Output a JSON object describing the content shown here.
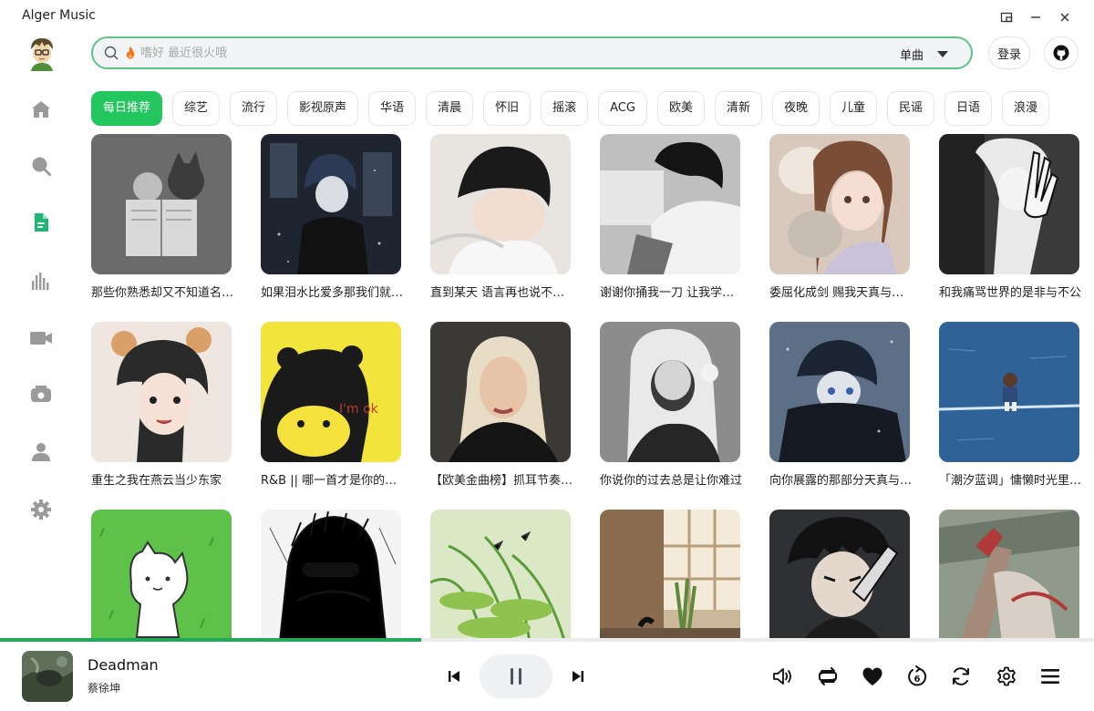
{
  "window": {
    "title": "Alger Music"
  },
  "search": {
    "placeholder": "嗜好 最近很火哦",
    "value": "",
    "type_label": "单曲"
  },
  "header": {
    "login_label": "登录"
  },
  "tabs": [
    "每日推荐",
    "综艺",
    "流行",
    "影视原声",
    "华语",
    "清晨",
    "怀旧",
    "摇滚",
    "ACG",
    "欧美",
    "清新",
    "夜晚",
    "儿童",
    "民谣",
    "日语",
    "浪漫"
  ],
  "active_tab": 0,
  "playlists": [
    {
      "title": "那些你熟悉却又不知道名字的歌"
    },
    {
      "title": "如果泪水比爱多那我们就不要再见了"
    },
    {
      "title": "直到某天 语言再也说不出口"
    },
    {
      "title": "谢谢你捅我一刀 让我学会了成长"
    },
    {
      "title": "委屈化成剑 赐我天真与勇敢"
    },
    {
      "title": "和我痛骂世界的是非与不公"
    },
    {
      "title": "重生之我在燕云当少东家"
    },
    {
      "title": "R&B || 哪一首才是你的心头好"
    },
    {
      "title": "【欧美金曲榜】抓耳节奏一听就上头"
    },
    {
      "title": "你说你的过去总是让你难过"
    },
    {
      "title": "向你展露的那部分天真与脆弱"
    },
    {
      "title": "「潮汐蓝调」慵懒时光里的温柔"
    },
    {
      "title": ""
    },
    {
      "title": ""
    },
    {
      "title": ""
    },
    {
      "title": ""
    },
    {
      "title": ""
    },
    {
      "title": ""
    }
  ],
  "player": {
    "title": "Deadman",
    "artist": "蔡徐坤",
    "progress": 0.385
  },
  "icons": {
    "minimize": "minimize-icon",
    "restore": "restore-icon",
    "close": "close-icon",
    "search": "search-icon",
    "fire": "fire-icon",
    "github": "github-icon",
    "nav": [
      "home-icon",
      "search-icon",
      "playlist-icon",
      "chart-icon",
      "video-icon",
      "radio-icon",
      "user-icon",
      "settings-icon"
    ]
  },
  "colors": {
    "accent": "#22c55e",
    "active_nav": "#22b573",
    "nav": "#9a9a9a"
  }
}
